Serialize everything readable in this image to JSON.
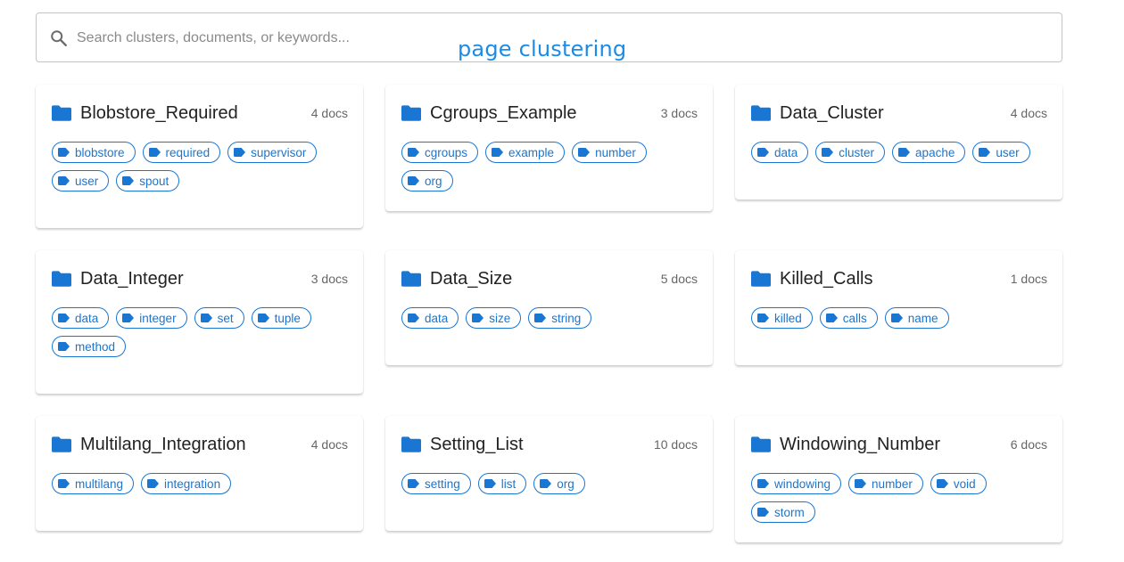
{
  "search": {
    "placeholder": "Search clusters, documents, or keywords...",
    "value": ""
  },
  "overlay_title": "page clustering",
  "colors": {
    "accent": "#1976d2",
    "overlay_title": "#1a8ce8",
    "count_text": "#666666"
  },
  "icons": {
    "search": "search-icon",
    "folder": "folder-icon",
    "tag": "tag-icon"
  },
  "clusters": [
    {
      "title": "Blobstore_Required",
      "count": "4 docs",
      "tags": [
        "blobstore",
        "required",
        "supervisor",
        "user",
        "spout"
      ]
    },
    {
      "title": "Cgroups_Example",
      "count": "3 docs",
      "tags": [
        "cgroups",
        "example",
        "number",
        "org"
      ]
    },
    {
      "title": "Data_Cluster",
      "count": "4 docs",
      "tags": [
        "data",
        "cluster",
        "apache",
        "user"
      ]
    },
    {
      "title": "Data_Integer",
      "count": "3 docs",
      "tags": [
        "data",
        "integer",
        "set",
        "tuple",
        "method"
      ]
    },
    {
      "title": "Data_Size",
      "count": "5 docs",
      "tags": [
        "data",
        "size",
        "string"
      ]
    },
    {
      "title": "Killed_Calls",
      "count": "1 docs",
      "tags": [
        "killed",
        "calls",
        "name"
      ]
    },
    {
      "title": "Multilang_Integration",
      "count": "4 docs",
      "tags": [
        "multilang",
        "integration"
      ]
    },
    {
      "title": "Setting_List",
      "count": "10 docs",
      "tags": [
        "setting",
        "list",
        "org"
      ]
    },
    {
      "title": "Windowing_Number",
      "count": "6 docs",
      "tags": [
        "windowing",
        "number",
        "void",
        "storm"
      ]
    }
  ]
}
